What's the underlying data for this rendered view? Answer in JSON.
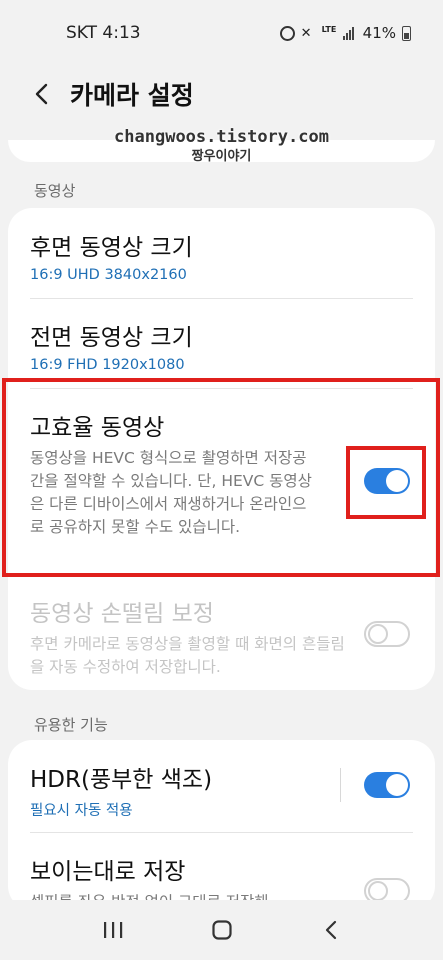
{
  "status_bar": {
    "carrier_time": "SKT 4:13",
    "lte_label": "LTE",
    "battery_percent": "41%",
    "icons": [
      "alarm-icon",
      "mute-icon",
      "lte-icon",
      "signal-icon",
      "battery-icon"
    ]
  },
  "header": {
    "title": "카메라 설정",
    "back_icon": "chevron-left-icon"
  },
  "watermark": {
    "line1": "changwoos.tistory.com",
    "line2": "짱우이야기"
  },
  "sections": {
    "video": {
      "label": "동영상",
      "items": [
        {
          "title": "후면 동영상 크기",
          "subtitle": "16:9 UHD 3840x2160"
        },
        {
          "title": "전면 동영상 크기",
          "subtitle": "16:9 FHD 1920x1080"
        },
        {
          "title": "고효율 동영상",
          "description": "동영상을 HEVC 형식으로 촬영하면 저장공간을 절약할 수 있습니다. 단, HEVC 동영상은 다른 디바이스에서 재생하거나 온라인으로 공유하지 못할 수도 있습니다.",
          "toggle": "on"
        },
        {
          "title": "동영상 손떨림 보정",
          "description": "후면 카메라로 동영상을 촬영할 때 화면의 흔들림을 자동 수정하여 저장합니다.",
          "toggle": "off",
          "disabled": true
        }
      ]
    },
    "useful": {
      "label": "유용한 기능",
      "items": [
        {
          "title": "HDR(풍부한 색조)",
          "subtitle": "필요시 자동 적용",
          "toggle": "on"
        },
        {
          "title": "보이는대로 저장",
          "description": "셀피를 좌우 반전 없이 그대로 저장해",
          "toggle": "off"
        }
      ]
    }
  },
  "colors": {
    "accent": "#2a7fe0",
    "subtitle_blue": "#1f6fb5",
    "highlight_red": "#e0201c",
    "background": "#f2f2f2"
  },
  "navbar": {
    "icons": [
      "recent-apps-icon",
      "home-icon",
      "back-icon"
    ]
  }
}
